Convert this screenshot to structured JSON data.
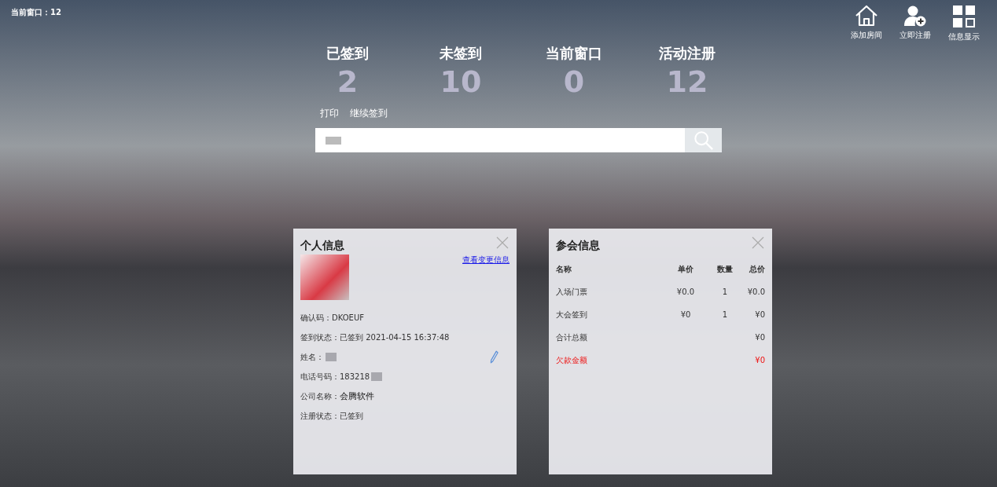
{
  "current_window": "当前窗口：12",
  "toolbar": [
    {
      "label": "添加房间",
      "kind": "house"
    },
    {
      "label": "立即注册",
      "kind": "user-add"
    },
    {
      "label": "信息显示",
      "kind": "grid"
    }
  ],
  "stats": [
    {
      "label": "已签到",
      "value": "2"
    },
    {
      "label": "未签到",
      "value": "10"
    },
    {
      "label": "当前窗口",
      "value": "0"
    },
    {
      "label": "活动注册",
      "value": "12"
    }
  ],
  "actions": [
    "打印",
    "继续签到"
  ],
  "personal": {
    "title": "个人信息",
    "link": "查看变更信息",
    "fields": [
      {
        "label": "确认码：",
        "value": "DKOEUF",
        "kind": "text",
        "editable": false
      },
      {
        "label": "签到状态：",
        "value": "已签到 2021-04-15 16:37:48",
        "kind": "text",
        "editable": false
      },
      {
        "label": "姓名：",
        "kind": "redacted",
        "editable": true
      },
      {
        "label": "电话号码：",
        "value": "183218",
        "kind": "partial",
        "editable": false
      },
      {
        "label": "公司名称：",
        "value": "会腾软件",
        "kind": "emphasis",
        "editable": false
      },
      {
        "label": "注册状态：",
        "value": "已签到",
        "kind": "text",
        "editable": false
      }
    ]
  },
  "meeting": {
    "title": "参会信息",
    "columns": [
      "名称",
      "单价",
      "数量",
      "总价"
    ],
    "rows": [
      {
        "kind": "item",
        "name": "入场门票",
        "price": "¥0.0",
        "qty": "1",
        "total": "¥0.0"
      },
      {
        "kind": "item",
        "name": "大会签到",
        "price": "¥0",
        "qty": "1",
        "total": "¥0"
      },
      {
        "kind": "sum",
        "name": "合计总额",
        "total": "¥0"
      },
      {
        "kind": "debt",
        "name": "欠款金额",
        "total": "¥0"
      }
    ]
  }
}
